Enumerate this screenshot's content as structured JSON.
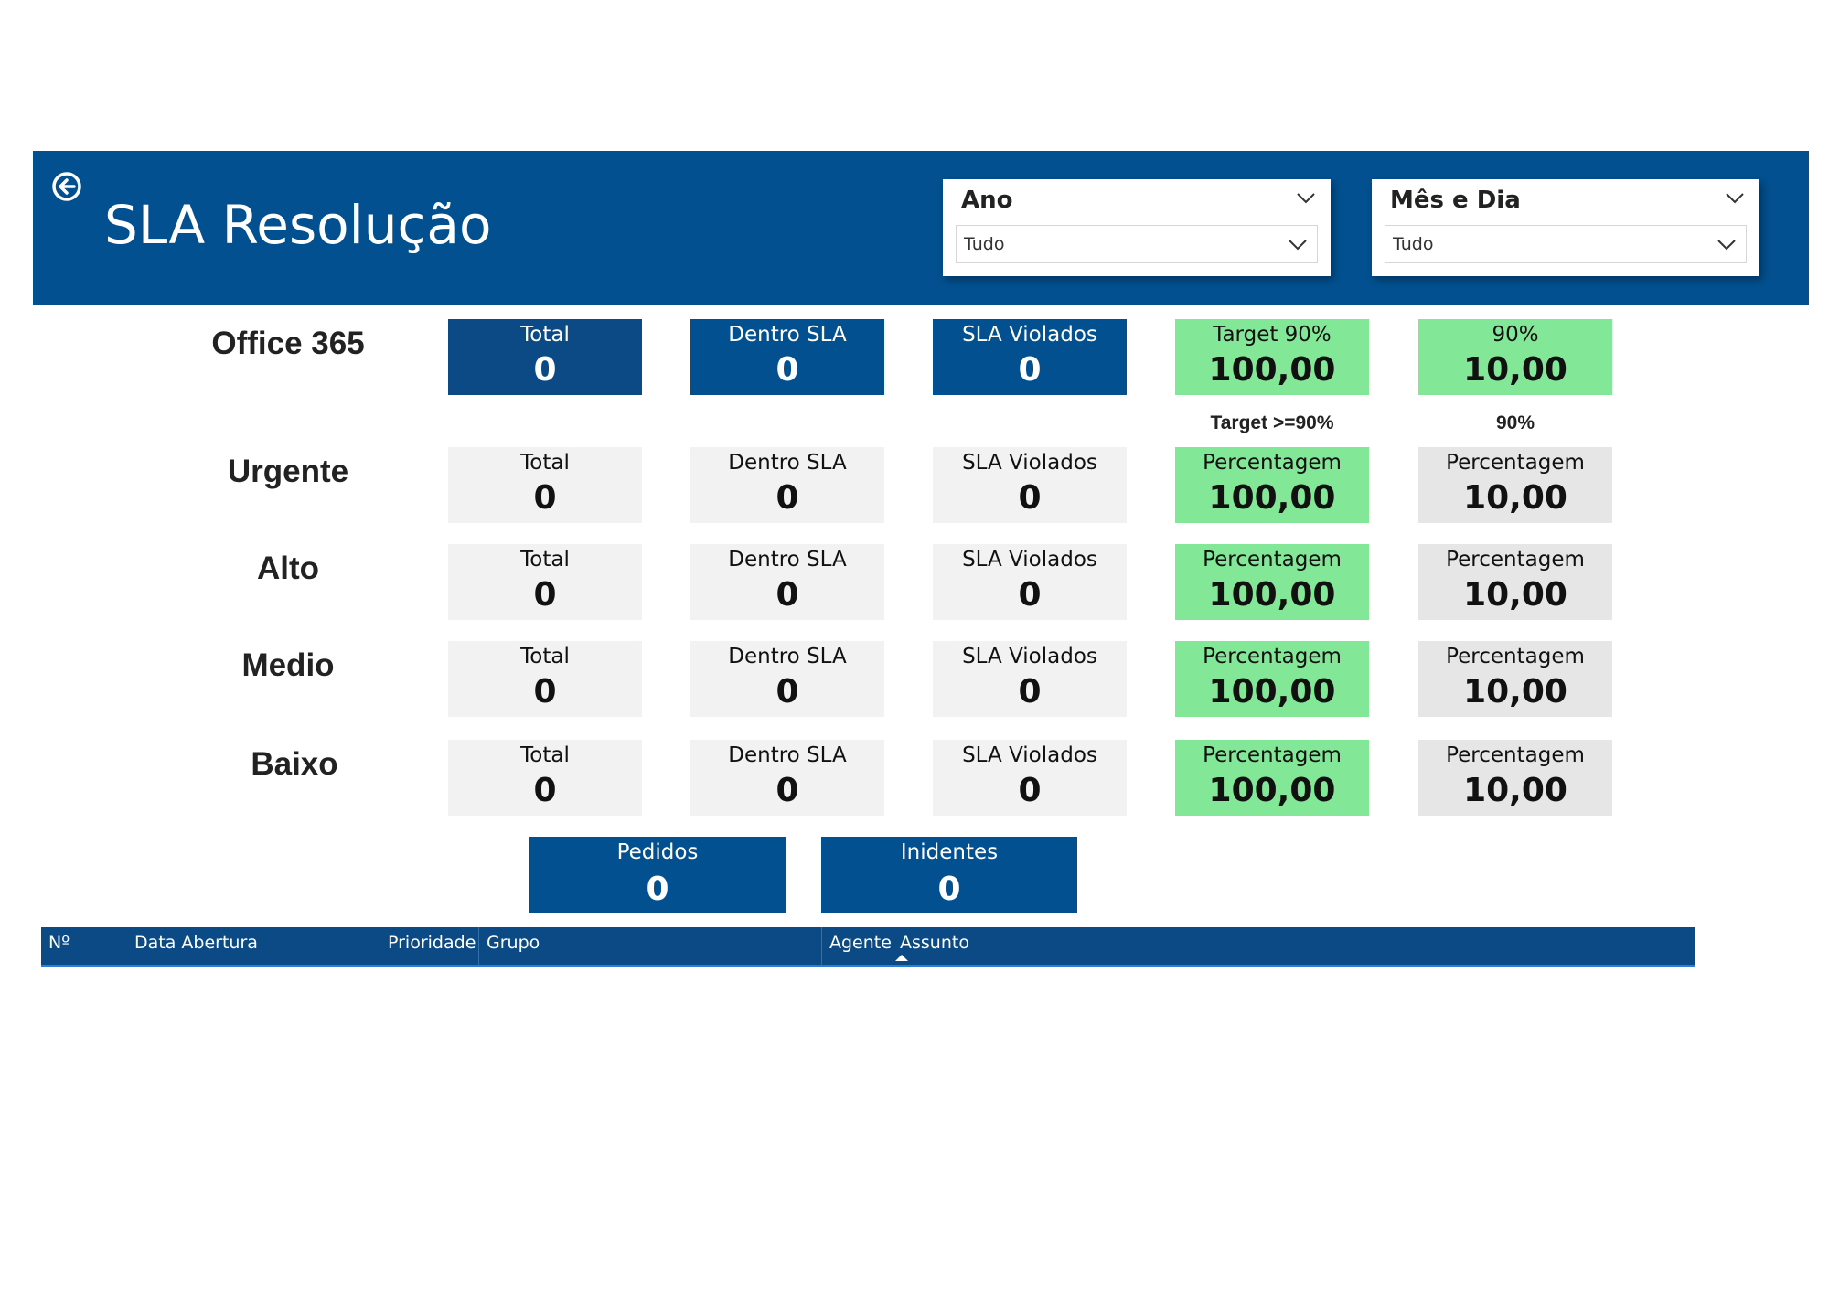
{
  "header": {
    "title": "SLA Resolução",
    "back_icon": "arrow-left-circle-icon",
    "filters": [
      {
        "label": "Ano",
        "value": "Tudo"
      },
      {
        "label": "Mês e Dia",
        "value": "Tudo"
      }
    ]
  },
  "office": {
    "label": "Office 365",
    "cards": [
      {
        "label": "Total",
        "value": "0"
      },
      {
        "label": "Dentro SLA",
        "value": "0"
      },
      {
        "label": "SLA Violados",
        "value": "0"
      },
      {
        "label": "Target 90%",
        "value": "100,00"
      },
      {
        "label": "90%",
        "value": "10,00"
      }
    ]
  },
  "column_subheaders": [
    "Target >=90%",
    "90%"
  ],
  "priorities": [
    {
      "label": "Urgente",
      "total_label": "Total",
      "total": "0",
      "dentro_label": "Dentro SLA",
      "dentro": "0",
      "violados_label": "SLA Violados",
      "violados": "0",
      "pct1_label": "Percentagem",
      "pct1": "100,00",
      "pct2_label": "Percentagem",
      "pct2": "10,00"
    },
    {
      "label": "Alto",
      "total_label": "Total",
      "total": "0",
      "dentro_label": "Dentro SLA",
      "dentro": "0",
      "violados_label": "SLA Violados",
      "violados": "0",
      "pct1_label": "Percentagem",
      "pct1": "100,00",
      "pct2_label": "Percentagem",
      "pct2": "10,00"
    },
    {
      "label": "Medio",
      "total_label": "Total",
      "total": "0",
      "dentro_label": "Dentro SLA",
      "dentro": "0",
      "violados_label": "SLA Violados",
      "violados": "0",
      "pct1_label": "Percentagem",
      "pct1": "100,00",
      "pct2_label": "Percentagem",
      "pct2": "10,00"
    },
    {
      "label": "Baixo",
      "total_label": "Total",
      "total": "0",
      "dentro_label": "Dentro SLA",
      "dentro": "0",
      "violados_label": "SLA Violados",
      "violados": "0",
      "pct1_label": "Percentagem",
      "pct1": "100,00",
      "pct2_label": "Percentagem",
      "pct2": "10,00"
    }
  ],
  "summary": [
    {
      "label": "Pedidos",
      "value": "0"
    },
    {
      "label": "Inidentes",
      "value": "0"
    }
  ],
  "table": {
    "columns": [
      "Nº",
      "Data Abertura",
      "Prioridade",
      "Grupo",
      "Agente",
      "Assunto"
    ]
  }
}
